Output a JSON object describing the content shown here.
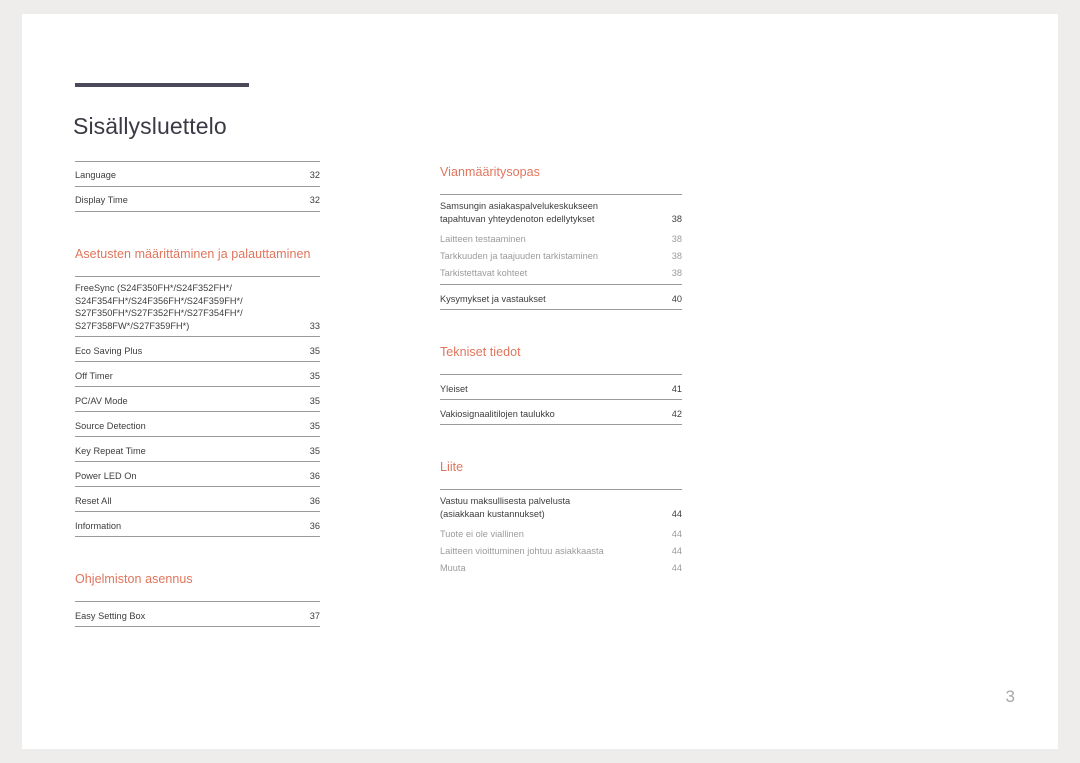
{
  "document": {
    "title": "Sisällysluettelo",
    "page_number": "3",
    "accent_color": "#e0755c",
    "rule_color": "#4a4a5a",
    "body_color": "#3c3c3c",
    "sub_color": "#9b9b9b",
    "background_color": "#eeedec",
    "page_color": "#ffffff"
  },
  "columns": {
    "left": {
      "groups": [
        {
          "heading": null,
          "rows": [
            {
              "label": "Language",
              "page": "32",
              "level": "main"
            },
            {
              "label": "Display Time",
              "page": "32",
              "level": "main"
            }
          ]
        },
        {
          "heading": "Asetusten määrittäminen ja palauttaminen",
          "rows": [
            {
              "label": "FreeSync (S24F350FH*/S24F352FH*/\nS24F354FH*/S24F356FH*/S24F359FH*/\nS27F350FH*/S27F352FH*/S27F354FH*/\nS27F358FW*/S27F359FH*)",
              "page": "33",
              "level": "main"
            },
            {
              "label": "Eco Saving Plus",
              "page": "35",
              "level": "main"
            },
            {
              "label": "Off Timer",
              "page": "35",
              "level": "main"
            },
            {
              "label": "PC/AV Mode",
              "page": "35",
              "level": "main"
            },
            {
              "label": "Source Detection",
              "page": "35",
              "level": "main"
            },
            {
              "label": "Key Repeat Time",
              "page": "35",
              "level": "main"
            },
            {
              "label": "Power LED On",
              "page": "36",
              "level": "main"
            },
            {
              "label": "Reset All",
              "page": "36",
              "level": "main"
            },
            {
              "label": "Information",
              "page": "36",
              "level": "main"
            }
          ]
        },
        {
          "heading": "Ohjelmiston asennus",
          "rows": [
            {
              "label": "Easy Setting Box",
              "page": "37",
              "level": "main"
            }
          ]
        }
      ]
    },
    "right": {
      "groups": [
        {
          "heading": "Vianmääritysopas",
          "rows": [
            {
              "label": "Samsungin asiakaspalvelukeskukseen\ntapahtuvan yhteydenoton edellytykset",
              "page": "38",
              "level": "main-no-rule"
            },
            {
              "label": "Laitteen testaaminen",
              "page": "38",
              "level": "sub"
            },
            {
              "label": "Tarkkuuden ja taajuuden tarkistaminen",
              "page": "38",
              "level": "sub"
            },
            {
              "label": "Tarkistettavat kohteet",
              "page": "38",
              "level": "sub-last"
            },
            {
              "label": "Kysymykset ja vastaukset",
              "page": "40",
              "level": "main"
            }
          ]
        },
        {
          "heading": "Tekniset tiedot",
          "rows": [
            {
              "label": "Yleiset",
              "page": "41",
              "level": "main"
            },
            {
              "label": "Vakiosignaalitilojen taulukko",
              "page": "42",
              "level": "main"
            }
          ]
        },
        {
          "heading": "Liite",
          "rows": [
            {
              "label": "Vastuu maksullisesta palvelusta\n(asiakkaan kustannukset)",
              "page": "44",
              "level": "main-no-rule"
            },
            {
              "label": "Tuote ei ole viallinen",
              "page": "44",
              "level": "sub"
            },
            {
              "label": "Laitteen vioittuminen johtuu asiakkaasta",
              "page": "44",
              "level": "sub"
            },
            {
              "label": "Muuta",
              "page": "44",
              "level": "sub"
            }
          ]
        }
      ]
    }
  }
}
